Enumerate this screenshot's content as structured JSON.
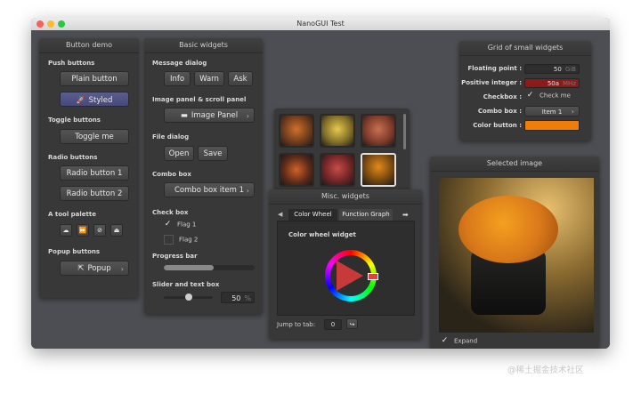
{
  "window": {
    "title": "NanoGUI Test"
  },
  "button_demo": {
    "title": "Button demo",
    "push_label": "Push buttons",
    "plain_button": "Plain button",
    "styled_button": "Styled",
    "toggle_label": "Toggle buttons",
    "toggle_button": "Toggle me",
    "radio_label": "Radio buttons",
    "radio1": "Radio button 1",
    "radio2": "Radio button 2",
    "palette_label": "A tool palette",
    "popup_label": "Popup buttons",
    "popup_button": "Popup",
    "palette_icons": [
      "cloud-icon",
      "fast-forward-icon",
      "compass-icon",
      "install-icon"
    ]
  },
  "basic_widgets": {
    "title": "Basic widgets",
    "message_label": "Message dialog",
    "info": "Info",
    "warn": "Warn",
    "ask": "Ask",
    "image_label": "Image panel & scroll panel",
    "image_button": "Image Panel",
    "file_label": "File dialog",
    "open": "Open",
    "save": "Save",
    "combo_label": "Combo box",
    "combo_value": "Combo box item 1",
    "check_label": "Check box",
    "flag1": "Flag 1",
    "flag1_checked": true,
    "flag2": "Flag 2",
    "flag2_checked": false,
    "progress_label": "Progress bar",
    "progress_value": 0.55,
    "slider_label": "Slider and text box",
    "slider_value": "50",
    "slider_unit": "%",
    "slider_fraction": 0.5
  },
  "grid": {
    "title": "Grid of small widgets",
    "floating_label": "Floating point :",
    "floating_value": "50",
    "floating_unit": "GiB",
    "integer_label": "Positive integer :",
    "integer_value": "50a",
    "integer_unit": "MHz",
    "checkbox_label": "Checkbox :",
    "checkbox_text": "Check me",
    "checkbox_checked": true,
    "combo_label": "Combo box :",
    "combo_value": "Item 1",
    "color_label": "Color button :",
    "color_value": "#f07c0a",
    "integer_error_color": "#8b1a1a"
  },
  "misc": {
    "title": "Misc. widgets",
    "tabs": [
      "Color Wheel",
      "Function Graph"
    ],
    "active_tab": 0,
    "wheel_label": "Color wheel widget",
    "jump_label": "Jump to tab:",
    "jump_value": "0"
  },
  "selected": {
    "title": "Selected image",
    "expand_label": "Expand",
    "expand_checked": true
  },
  "watermark": "@稀土掘金技术社区"
}
